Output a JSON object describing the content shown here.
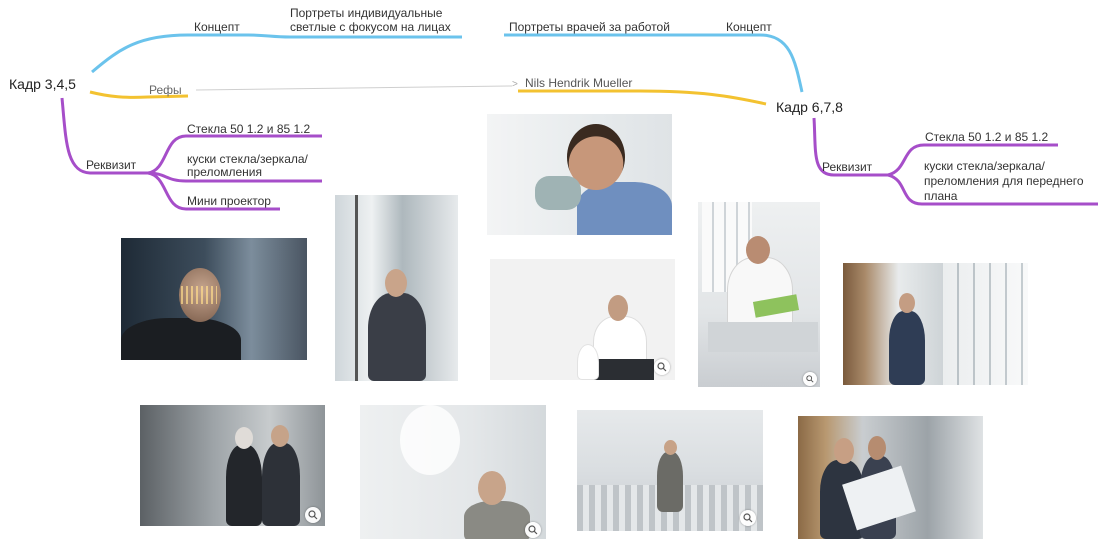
{
  "mindmap": {
    "colors": {
      "blue": "#6bc3ec",
      "yellow": "#f3c230",
      "purple": "#a64ec9"
    },
    "left_root": {
      "label": "Кадр 3,4,5",
      "concept": "Концепт",
      "concept_items": [
        "Портреты индивидуальные",
        "светлые с фокусом на лицах"
      ],
      "refs": "Рефы",
      "props": "Реквизит",
      "props_items": [
        "Стекла 50 1.2 и 85 1.2",
        "куски стекла/зеркала/",
        "преломления",
        "Мини проектор"
      ]
    },
    "right_root": {
      "label": "Кадр 6,7,8",
      "concept": "Концепт",
      "concept_item": "Портреты врачей за работой",
      "ref_item": "Nils Hendrik Mueller",
      "props": "Реквизит",
      "props_items": [
        "Стекла 50 1.2 и 85 1.2",
        "куски стекла/зеркала/",
        "преломления для переднего",
        "плана"
      ]
    },
    "link_arrow": ">"
  },
  "photos": [
    {
      "name": "photo-man-face-projection",
      "zoom": false
    },
    {
      "name": "photo-man-suit-glass-office",
      "zoom": false
    },
    {
      "name": "photo-man-curly-hair-holding-object",
      "zoom": false
    },
    {
      "name": "photo-man-sitting-white-studio",
      "zoom": true
    },
    {
      "name": "photo-chef-reading",
      "zoom": true
    },
    {
      "name": "photo-man-corridor",
      "zoom": false
    },
    {
      "name": "photo-two-men-factory",
      "zoom": true
    },
    {
      "name": "photo-man-chin-on-hand",
      "zoom": true
    },
    {
      "name": "photo-man-hall-standing",
      "zoom": true
    },
    {
      "name": "photo-men-reading-blueprint",
      "zoom": false
    }
  ]
}
